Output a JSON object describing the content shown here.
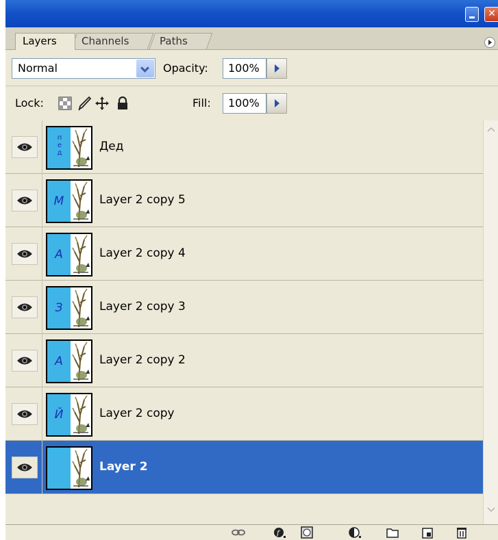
{
  "panel": {
    "title_buttons": [
      "minimize-icon",
      "close-icon"
    ],
    "tabs": [
      {
        "label": "Layers",
        "active": true
      },
      {
        "label": "Channels",
        "active": false
      },
      {
        "label": "Paths",
        "active": false
      }
    ],
    "blend_mode": "Normal",
    "opacity_label": "Opacity:",
    "opacity_value": "100%",
    "lock_label": "Lock:",
    "fill_label": "Fill:",
    "fill_value": "100%",
    "lock_icons": [
      "lock-transparent-icon",
      "lock-image-icon",
      "lock-position-icon",
      "lock-all-icon"
    ]
  },
  "layers": [
    {
      "name": "Дед",
      "thumb_letter": "",
      "thumb_vertical": "п\nе\nд",
      "visible": true,
      "selected": false
    },
    {
      "name": "Layer 2 copy 5",
      "thumb_letter": "М",
      "visible": true,
      "selected": false
    },
    {
      "name": "Layer 2 copy 4",
      "thumb_letter": "А",
      "visible": true,
      "selected": false
    },
    {
      "name": "Layer 2 copy 3",
      "thumb_letter": "З",
      "visible": true,
      "selected": false
    },
    {
      "name": "Layer 2 copy 2",
      "thumb_letter": "А",
      "visible": true,
      "selected": false
    },
    {
      "name": "Layer 2 copy",
      "thumb_letter": "Й",
      "visible": true,
      "selected": false
    },
    {
      "name": "Layer 2",
      "thumb_letter": "",
      "visible": true,
      "selected": true
    }
  ],
  "bottom_icons": [
    "link-layers-icon",
    "layer-style-icon",
    "layer-mask-icon",
    "adjustment-layer-icon",
    "new-group-icon",
    "new-layer-icon",
    "delete-layer-icon"
  ],
  "colors": {
    "selection": "#316ac5",
    "panel_bg": "#ece9d8",
    "thumb_blue": "#3fb4e6",
    "titlebar": "#1552c7"
  }
}
